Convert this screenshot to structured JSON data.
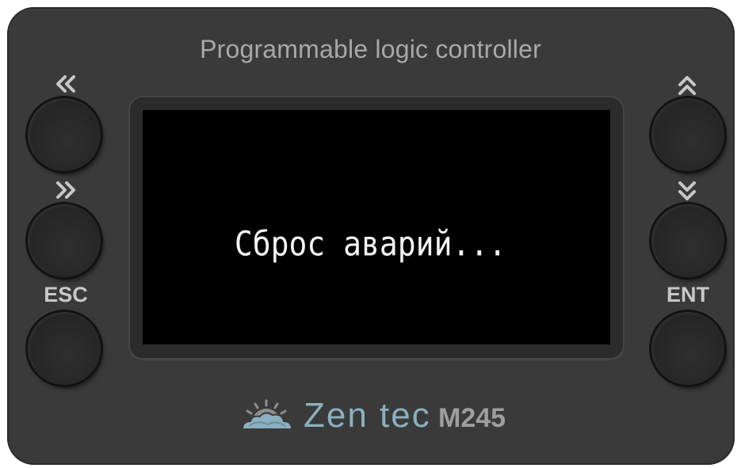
{
  "device": {
    "title": "Programmable logic controller",
    "display_text": "Сброс аварий...",
    "brand": "Zen tec",
    "model": "M245"
  },
  "buttons": {
    "left_top": {
      "icon": "double-chevron-left-icon"
    },
    "left_middle": {
      "icon": "double-chevron-right-icon"
    },
    "left_bottom": {
      "label": "ESC"
    },
    "right_top": {
      "icon": "double-chevron-up-icon"
    },
    "right_middle": {
      "icon": "double-chevron-down-icon"
    },
    "right_bottom": {
      "label": "ENT"
    }
  },
  "colors": {
    "panel": "#3a3a3a",
    "screen": "#000000",
    "screen_text": "#f4f4f4",
    "brand_accent": "#8bb0bf",
    "label": "#c8c8c8"
  }
}
